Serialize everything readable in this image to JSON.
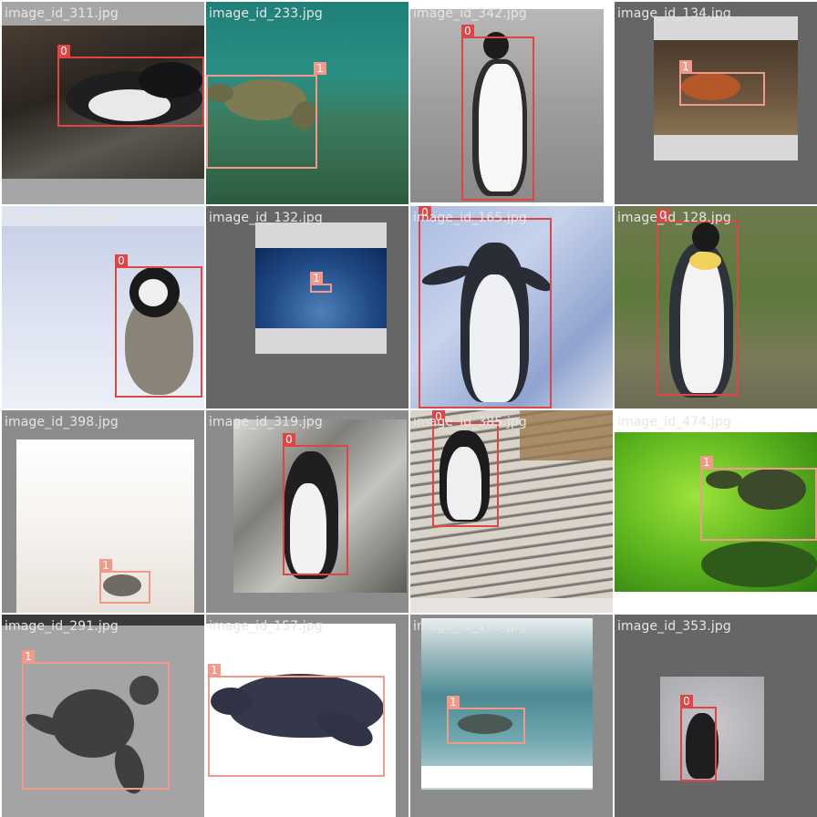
{
  "gallery": {
    "tiles": [
      {
        "filename": "image_id_311.jpg",
        "boxes": [
          {
            "label": "0"
          }
        ]
      },
      {
        "filename": "image_id_233.jpg",
        "boxes": [
          {
            "label": "1"
          }
        ]
      },
      {
        "filename": "image_id_342.jpg",
        "boxes": [
          {
            "label": "0"
          }
        ]
      },
      {
        "filename": "image_id_134.jpg",
        "boxes": [
          {
            "label": "1"
          }
        ]
      },
      {
        "filename": "image_id_430.jpg",
        "boxes": [
          {
            "label": "0"
          }
        ]
      },
      {
        "filename": "image_id_132.jpg",
        "boxes": [
          {
            "label": "1"
          }
        ]
      },
      {
        "filename": "image_id_165.jpg",
        "boxes": [
          {
            "label": "0"
          }
        ]
      },
      {
        "filename": "image_id_128.jpg",
        "boxes": [
          {
            "label": "0"
          }
        ]
      },
      {
        "filename": "image_id_398.jpg",
        "boxes": [
          {
            "label": "1"
          }
        ]
      },
      {
        "filename": "image_id_319.jpg",
        "boxes": [
          {
            "label": "0"
          }
        ]
      },
      {
        "filename": "image_id_385.jpg",
        "boxes": [
          {
            "label": "0"
          }
        ]
      },
      {
        "filename": "image_id_474.jpg",
        "boxes": [
          {
            "label": "1"
          }
        ]
      },
      {
        "filename": "image_id_291.jpg",
        "boxes": [
          {
            "label": "1"
          }
        ]
      },
      {
        "filename": "image_id_157.jpg",
        "boxes": [
          {
            "label": "1"
          }
        ]
      },
      {
        "filename": "image_id_163.jpg",
        "boxes": [
          {
            "label": "1"
          }
        ]
      },
      {
        "filename": "image_id_353.jpg",
        "boxes": [
          {
            "label": "0"
          }
        ]
      }
    ]
  },
  "colors": {
    "class_0": "#e04545",
    "class_1": "#f19a8c",
    "filename_text": "#e6e6e6"
  }
}
